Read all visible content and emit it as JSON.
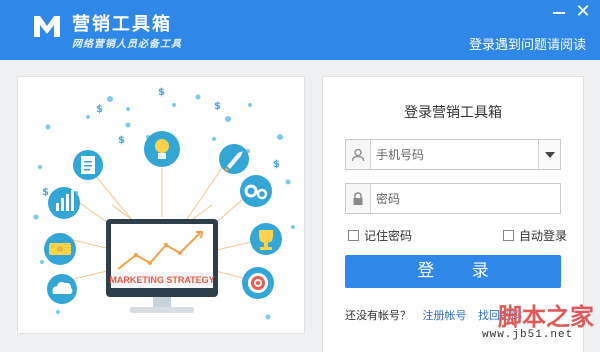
{
  "window": {
    "title": "营销工具箱",
    "slogan": "网络营销人员必备工具",
    "help_link": "登录遇到问题请阅读",
    "close_glyph": "✕"
  },
  "illustration": {
    "banner_text": "MARKETING STRATEGY",
    "dollar_symbol": "$"
  },
  "login": {
    "title": "登录营销工具箱",
    "phone_placeholder": "手机号码",
    "password_placeholder": "密码",
    "remember_label": "记住密码",
    "autologin_label": "自动登录",
    "login_button": "登 录",
    "no_account_text": "还没有帐号？",
    "register_link": "注册帐号",
    "other_link": "找回密码"
  },
  "watermark": {
    "main": "脚本之家",
    "sub": "www.jb51.net"
  },
  "colors": {
    "accent": "#2f87e8",
    "panel_bg": "#eef0f2",
    "link": "#2f6fc8",
    "watermark": "#e15a5a"
  },
  "icons": [
    "logo-m-icon",
    "minimize-icon",
    "close-icon",
    "user-icon",
    "lock-icon",
    "chevron-down-icon",
    "lightbulb-icon",
    "rocket-icon",
    "gears-icon",
    "trophy-icon",
    "target-icon",
    "document-icon",
    "bar-chart-icon",
    "money-icon",
    "cloud-icon",
    "monitor-icon"
  ]
}
